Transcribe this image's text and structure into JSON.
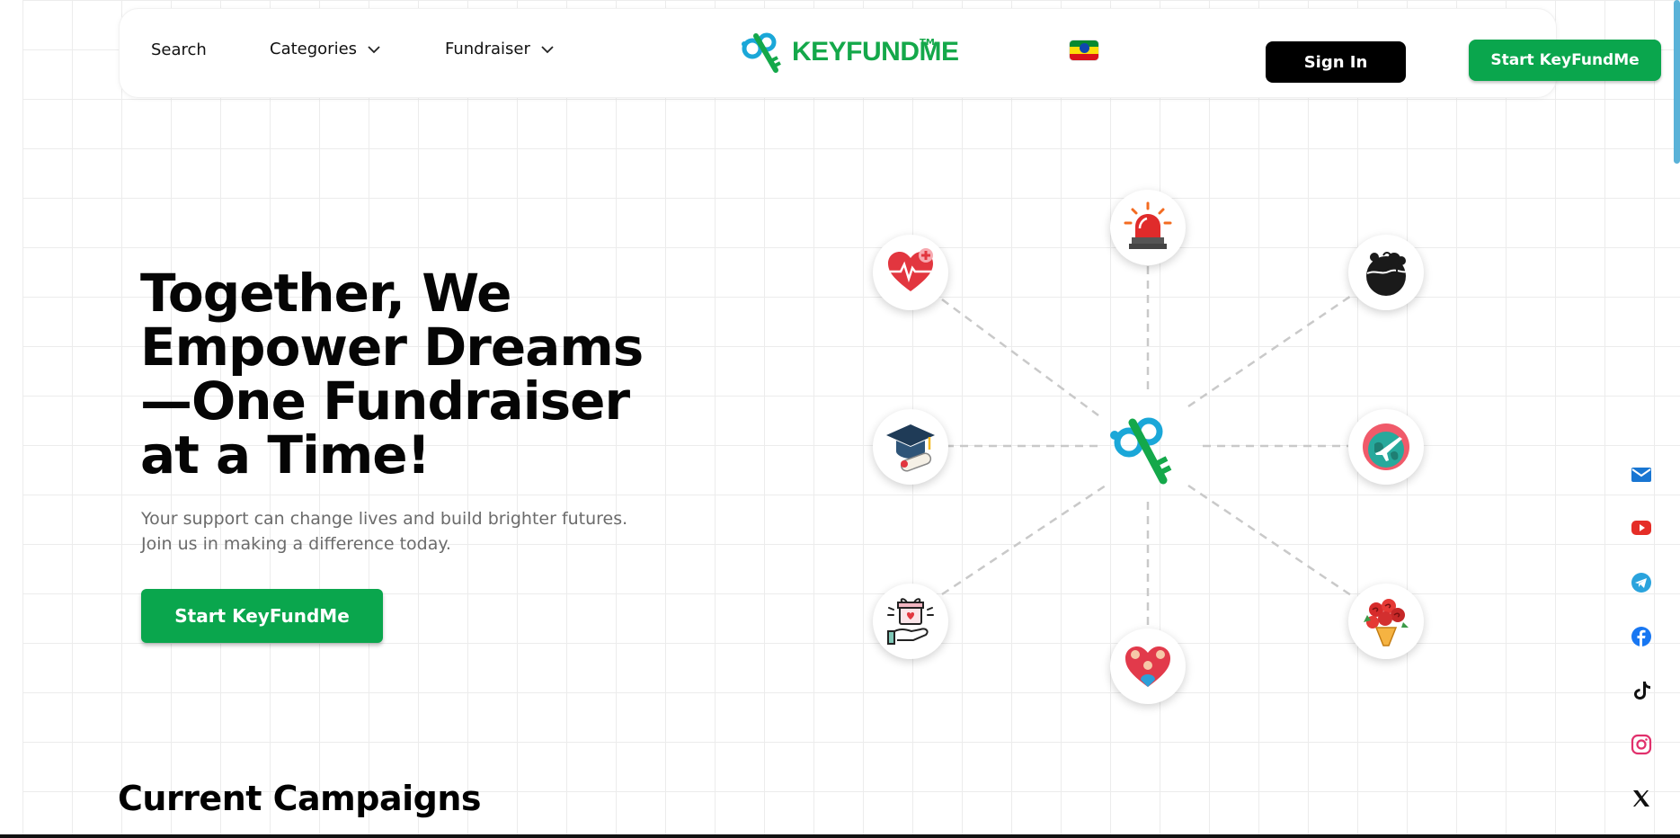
{
  "header": {
    "search_label": "Search",
    "categories_label": "Categories",
    "fundraiser_label": "Fundraiser",
    "logo_text": "KEYFUNDME",
    "logo_tm": "TM",
    "signin_label": "Sign In",
    "start_label": "Start KeyFundMe"
  },
  "hero": {
    "title_line1": "Together, We",
    "title_line2": "Empower Dreams",
    "title_line3": "—One Fundraiser",
    "title_line4": "at a Time!",
    "subtitle_line1": "Your support can change lives and build brighter futures.",
    "subtitle_line2": "Join us in making a difference today.",
    "cta_label": "Start KeyFundMe"
  },
  "network": {
    "nodes": [
      {
        "icon": "medical-heart-icon"
      },
      {
        "icon": "emergency-siren-icon"
      },
      {
        "icon": "environment-trees-icon"
      },
      {
        "icon": "graduation-cap-icon"
      },
      {
        "icon": "travel-globe-plane-icon"
      },
      {
        "icon": "gift-hand-icon"
      },
      {
        "icon": "community-heart-icon"
      },
      {
        "icon": "flower-bouquet-icon"
      }
    ]
  },
  "campaigns": {
    "heading": "Current Campaigns"
  },
  "social": [
    "email-icon",
    "youtube-icon",
    "telegram-icon",
    "facebook-icon",
    "tiktok-icon",
    "instagram-icon",
    "x-icon"
  ],
  "colors": {
    "brand_green": "#0aa64d",
    "brand_blue": "#1aa7d8",
    "text_dark": "#050505",
    "text_muted": "#6b6b6b"
  }
}
